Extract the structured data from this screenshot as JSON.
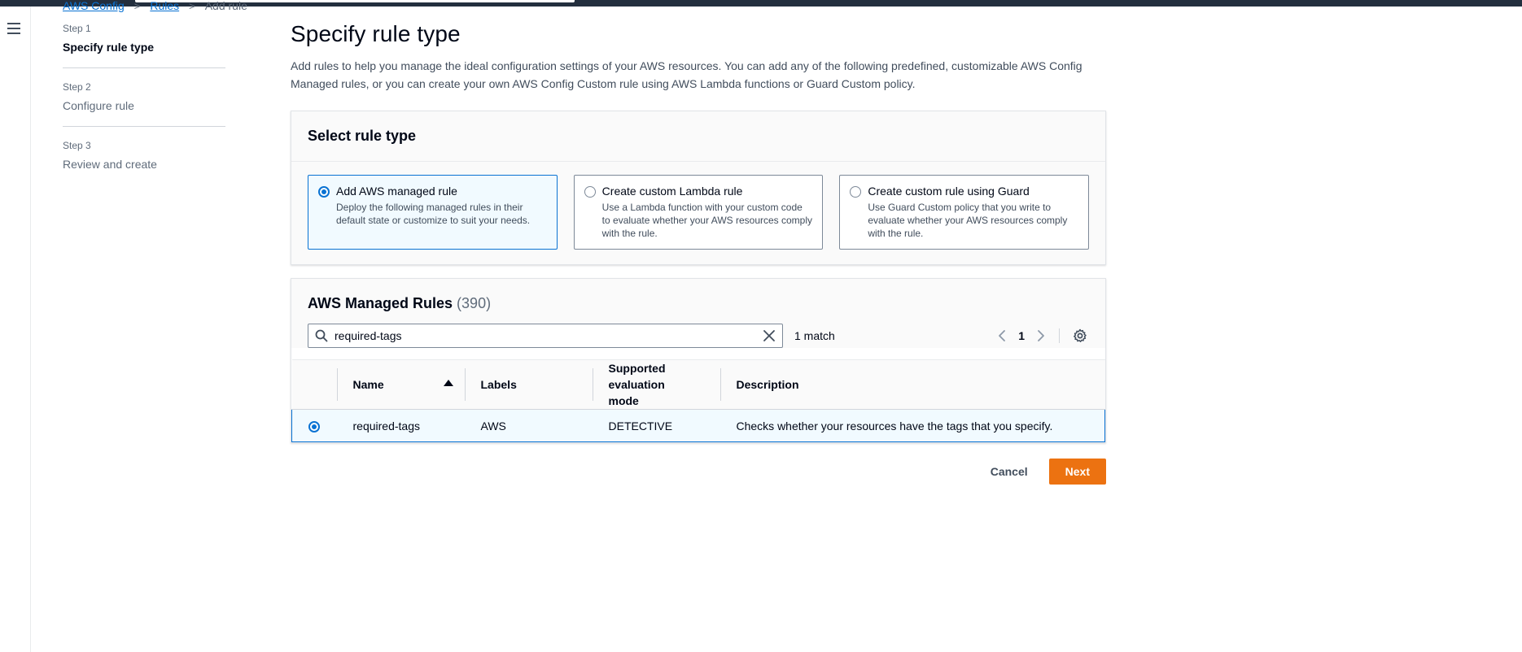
{
  "breadcrumb": {
    "item1": "AWS Config",
    "item2": "Rules",
    "current": "Add rule"
  },
  "steps": [
    {
      "num": "Step 1",
      "label": "Specify rule type"
    },
    {
      "num": "Step 2",
      "label": "Configure rule"
    },
    {
      "num": "Step 3",
      "label": "Review and create"
    }
  ],
  "page": {
    "title": "Specify rule type",
    "description": "Add rules to help you manage the ideal configuration settings of your AWS resources. You can add any of the following predefined, customizable AWS Config Managed rules, or you can create your own AWS Config Custom rule using AWS Lambda functions or Guard Custom policy."
  },
  "rule_type": {
    "title": "Select rule type",
    "options": [
      {
        "title": "Add AWS managed rule",
        "desc": "Deploy the following managed rules in their default state or customize to suit your needs.",
        "selected": true
      },
      {
        "title": "Create custom Lambda rule",
        "desc": "Use a Lambda function with your custom code to evaluate whether your AWS resources comply with the rule.",
        "selected": false
      },
      {
        "title": "Create custom rule using Guard",
        "desc": "Use Guard Custom policy that you write to evaluate whether your AWS resources comply with the rule.",
        "selected": false
      }
    ]
  },
  "managed_rules": {
    "title": "AWS Managed Rules",
    "count": "(390)",
    "search_value": "required-tags",
    "match_text": "1 match",
    "page_number": "1",
    "columns": {
      "name": "Name",
      "labels": "Labels",
      "mode": "Supported evaluation mode",
      "description": "Description"
    },
    "rows": [
      {
        "name": "required-tags",
        "labels": "AWS",
        "mode": "DETECTIVE",
        "description": "Checks whether your resources have the tags that you specify.",
        "selected": true
      }
    ]
  },
  "actions": {
    "cancel": "Cancel",
    "next": "Next"
  },
  "colors": {
    "accent": "#0972d3",
    "primary_button": "#ec7211",
    "topbar": "#232f3e"
  },
  "icons": [
    "menu-icon",
    "search-icon",
    "clear-icon",
    "chevron-left-icon",
    "chevron-right-icon",
    "settings-gear-icon",
    "sort-ascending-icon"
  ]
}
